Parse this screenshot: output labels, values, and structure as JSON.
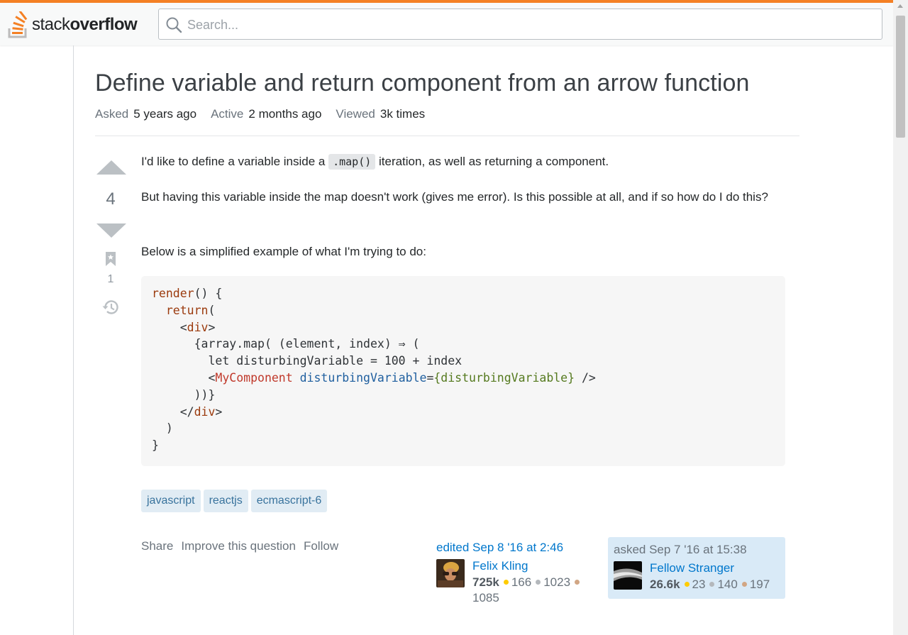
{
  "header": {
    "logo_text_light": "stack",
    "logo_text_bold": "overflow",
    "search_placeholder": "Search..."
  },
  "question": {
    "title": "Define variable and return component from an arrow function",
    "meta": {
      "asked_label": "Asked",
      "asked_value": "5 years ago",
      "active_label": "Active",
      "active_value": "2 months ago",
      "viewed_label": "Viewed",
      "viewed_value": "3k times"
    },
    "votes": "4",
    "bookmarks": "1",
    "body": {
      "p1_before": "I'd like to define a variable inside a ",
      "p1_code": ".map()",
      "p1_after": " iteration, as well as returning a component.",
      "p2": "But having this variable inside the map doesn't work (gives me error). Is this possible at all, and if so how do I do this?",
      "p3": "Below is a simplified example of what I'm trying to do:"
    },
    "code": {
      "l1_fn": "render",
      "l1_rest": "() {",
      "l2_indent": "  ",
      "l2_kw": "return",
      "l2_rest": "(",
      "l3_indent": "    <",
      "l3_tag": "div",
      "l3_rest": ">",
      "l4": "      {array.map( (element, index) ⇒ (",
      "l5": "        let disturbingVariable = 100 + index",
      "l6_indent": "        <",
      "l6_comp": "MyComponent",
      "l6_attr": " disturbingVariable",
      "l6_eq": "=",
      "l6_val": "{disturbingVariable}",
      "l6_rest": " />",
      "l7": "      ))}",
      "l8_indent": "    </",
      "l8_tag": "div",
      "l8_rest": ">",
      "l9": "  )",
      "l10": "}"
    },
    "tags": [
      "javascript",
      "reactjs",
      "ecmascript-6"
    ],
    "menu": {
      "share": "Share",
      "improve": "Improve this question",
      "follow": "Follow"
    },
    "editor": {
      "action": "edited Sep 8 '16 at 2:46",
      "name": "Felix Kling",
      "rep": "725k",
      "gold": "166",
      "silver": "1023",
      "bronze": "1085"
    },
    "owner": {
      "action": "asked Sep 7 '16 at 15:38",
      "name": "Fellow Stranger",
      "rep": "26.6k",
      "gold": "23",
      "silver": "140",
      "bronze": "197"
    }
  },
  "colors": {
    "brand": "#f48024",
    "link": "#0077cc",
    "tag_bg": "#e1ecf4",
    "tag_text": "#39739d"
  }
}
